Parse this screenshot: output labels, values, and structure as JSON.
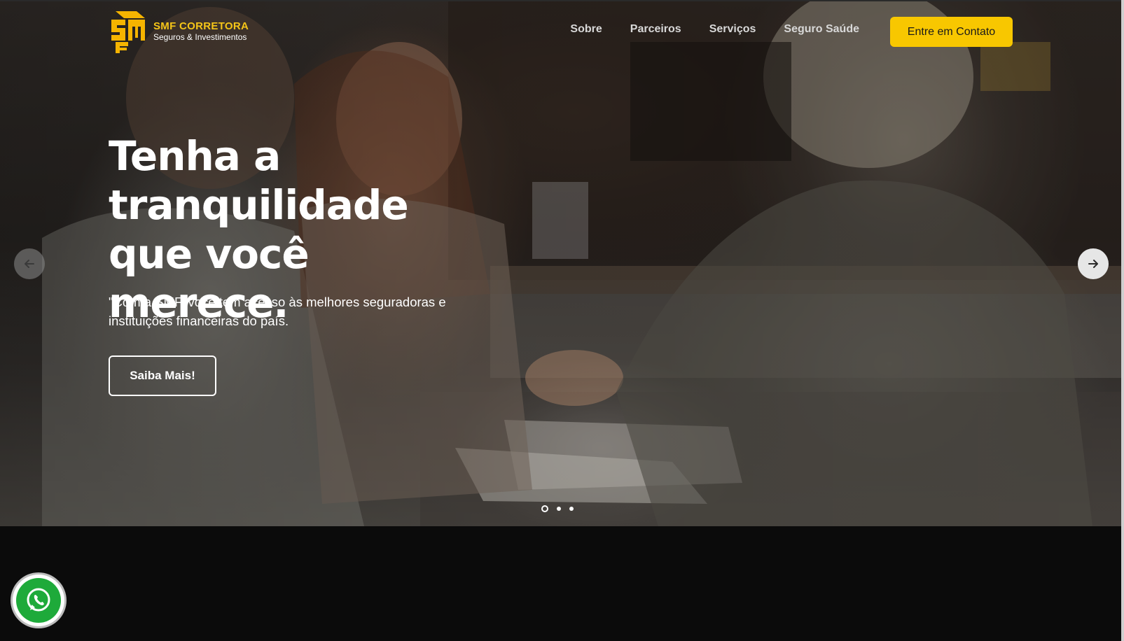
{
  "brand": {
    "name": "SMF CORRETORA",
    "tagline": "Seguros & Investimentos",
    "accent_color": "#f8c700"
  },
  "nav": {
    "items": [
      {
        "label": "Sobre"
      },
      {
        "label": "Parceiros"
      },
      {
        "label": "Serviços"
      },
      {
        "label": "Seguro Saúde"
      }
    ],
    "cta_label": "Entre em Contato"
  },
  "hero": {
    "headline": "Tenha a tranquilidade que você merece.",
    "subtitle": "\"Com a SMF, você tem acesso às melhores seguradoras e instituições financeiras do país.",
    "button_label": "Saiba Mais!",
    "slides_count": 3,
    "active_slide": 1
  },
  "icons": {
    "logo": "smf-logo-icon",
    "prev": "arrow-left-icon",
    "next": "arrow-right-icon",
    "chat": "whatsapp-icon"
  }
}
